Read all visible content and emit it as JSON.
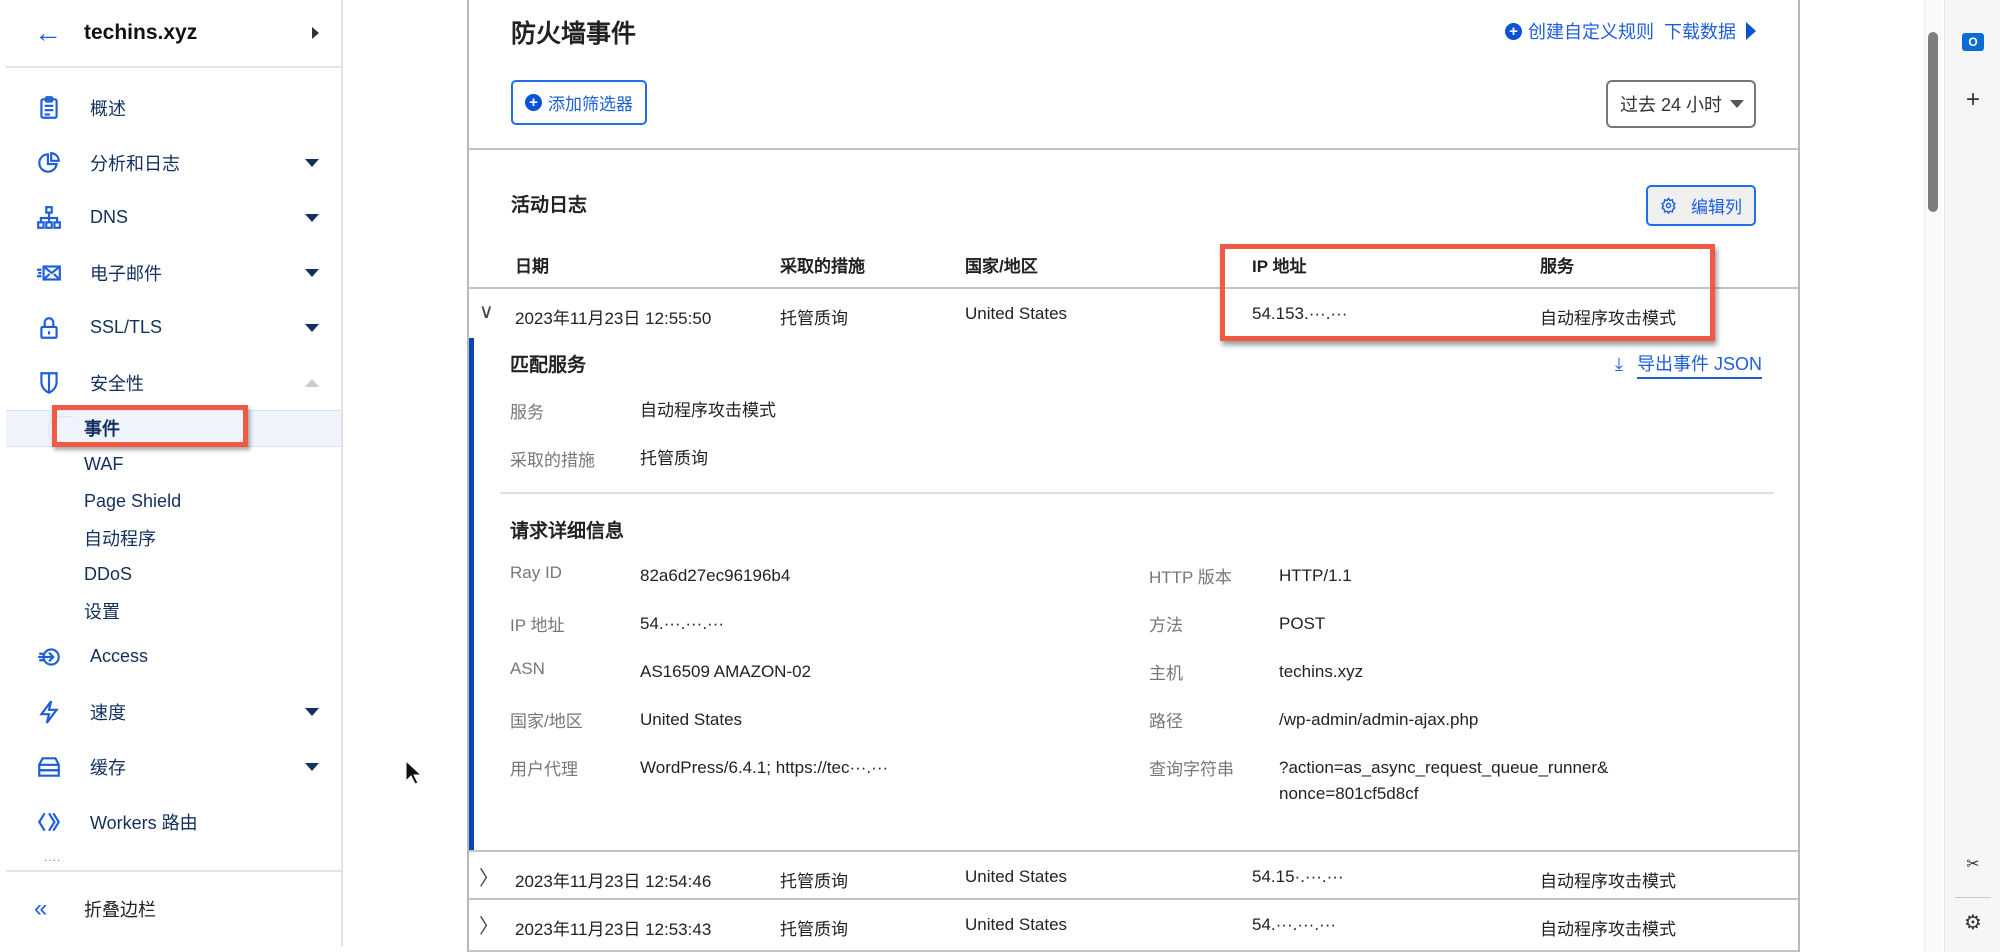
{
  "sidebar": {
    "back_icon": "arrow-left-icon",
    "site_name": "techins.xyz",
    "items": [
      {
        "label": "概述",
        "icon": "clipboard-icon",
        "has_dropdown": false
      },
      {
        "label": "分析和日志",
        "icon": "pie-chart-icon",
        "has_dropdown": true
      },
      {
        "label": "DNS",
        "icon": "sitemap-icon",
        "has_dropdown": true
      },
      {
        "label": "电子邮件",
        "icon": "email-icon",
        "has_dropdown": true
      },
      {
        "label": "SSL/TLS",
        "icon": "lock-icon",
        "has_dropdown": true
      },
      {
        "label": "安全性",
        "icon": "shield-icon",
        "has_dropdown": true,
        "expanded": true
      }
    ],
    "security_sub": [
      "事件",
      "WAF",
      "Page Shield",
      "自动程序",
      "DDoS",
      "设置"
    ],
    "active_sub": "事件",
    "items_after": [
      {
        "label": "Access",
        "icon": "access-icon",
        "has_dropdown": false
      },
      {
        "label": "速度",
        "icon": "lightning-icon",
        "has_dropdown": true
      },
      {
        "label": "缓存",
        "icon": "storage-icon",
        "has_dropdown": true
      },
      {
        "label": "Workers 路由",
        "icon": "workers-icon",
        "has_dropdown": false
      }
    ],
    "collapse_label": "折叠边栏"
  },
  "header": {
    "title": "防火墙事件",
    "add_filter_label": "添加筛选器",
    "create_rule_label": "创建自定义规则",
    "download_label": "下载数据",
    "time_range": "过去 24 小时"
  },
  "activity_log": {
    "title": "活动日志",
    "edit_columns_label": "编辑列",
    "columns": [
      "日期",
      "采取的措施",
      "国家/地区",
      "IP 地址",
      "服务"
    ],
    "rows": [
      {
        "date": "2023年11月23日 12:55:50",
        "action": "托管质询",
        "country": "United States",
        "ip": "54.153.···.···",
        "service": "自动程序攻击模式",
        "expanded": true
      },
      {
        "date": "2023年11月23日 12:54:46",
        "action": "托管质询",
        "country": "United States",
        "ip": "54.15·.···.···",
        "service": "自动程序攻击模式",
        "expanded": false
      },
      {
        "date": "2023年11月23日 12:53:43",
        "action": "托管质询",
        "country": "United States",
        "ip": "54.···.···.···",
        "service": "自动程序攻击模式",
        "expanded": false
      }
    ]
  },
  "detail": {
    "matched_title": "匹配服务",
    "export_label": "导出事件 JSON",
    "matched": [
      {
        "key": "服务",
        "value": "自动程序攻击模式"
      },
      {
        "key": "采取的措施",
        "value": "托管质询"
      }
    ],
    "request_title": "请求详细信息",
    "request_left": [
      {
        "key": "Ray ID",
        "value": "82a6d27ec96196b4"
      },
      {
        "key": "IP 地址",
        "value": "54.···.···.···"
      },
      {
        "key": "ASN",
        "value": "AS16509 AMAZON-02"
      },
      {
        "key": "国家/地区",
        "value": "United States"
      },
      {
        "key": "用户代理",
        "value": "WordPress/6.4.1; https://tec···.···"
      }
    ],
    "request_right": [
      {
        "key": "HTTP 版本",
        "value": "HTTP/1.1"
      },
      {
        "key": "方法",
        "value": "POST"
      },
      {
        "key": "主机",
        "value": "techins.xyz"
      },
      {
        "key": "路径",
        "value": "/wp-admin/admin-ajax.php"
      },
      {
        "key": "查询字符串",
        "value": "?action=as_async_request_queue_runner&nonce=801cf5d8cf"
      }
    ]
  },
  "colors": {
    "accent": "#1e5fd9",
    "annotation": "#f05a44",
    "detail_bar": "#0a44b5"
  }
}
